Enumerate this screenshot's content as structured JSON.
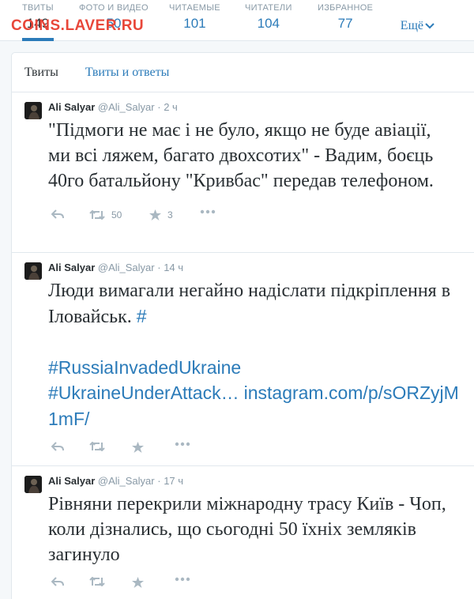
{
  "stats": [
    {
      "label": "ТВИТЫ",
      "value": "149"
    },
    {
      "label": "ФОТО И ВИДЕО",
      "value": "50"
    },
    {
      "label": "ЧИТАЕМЫЕ",
      "value": "101"
    },
    {
      "label": "ЧИТАТЕЛИ",
      "value": "104"
    },
    {
      "label": "ИЗБРАННОЕ",
      "value": "77"
    }
  ],
  "more_label": "Ещё",
  "watermark": "COINS.LAVER.RU",
  "tabs": {
    "tweets": "Твиты",
    "tweets_replies": "Твиты и ответы"
  },
  "tweets": [
    {
      "name": "Ali Salyar",
      "handle": "@Ali_Salyar",
      "time": "· 2 ч",
      "text": "\"Підмоги не має і не було, якщо не буде авіації, ми всі ляжем, багато двохсотих\" - Вадим, боєць 40го батальйону \"Кривбас\" передав телефоном.",
      "retweets": "50",
      "favorites": "3"
    },
    {
      "name": "Ali Salyar",
      "handle": "@Ali_Salyar",
      "time": "· 14 ч",
      "text": "Люди вимагали негайно надіслати підкріплення в Іловайськ.",
      "hash": "#",
      "link1": "#RussiaInvadedUkraine",
      "link2": "#UkraineUnderAttack…",
      "link3": "instagram.com/p/sORZyjM1mF/",
      "retweets": "",
      "favorites": ""
    },
    {
      "name": "Ali Salyar",
      "handle": "@Ali_Salyar",
      "time": "· 17 ч",
      "text": "Рівняни перекрили міжнародну трасу Київ - Чоп, коли дізнались, що сьогодні 50 їхніх земляків загинуло",
      "retweets": "",
      "favorites": ""
    }
  ],
  "colors": {
    "accent": "#2b7bb9",
    "muted": "#8899a6",
    "icon": "#aab8c2"
  }
}
